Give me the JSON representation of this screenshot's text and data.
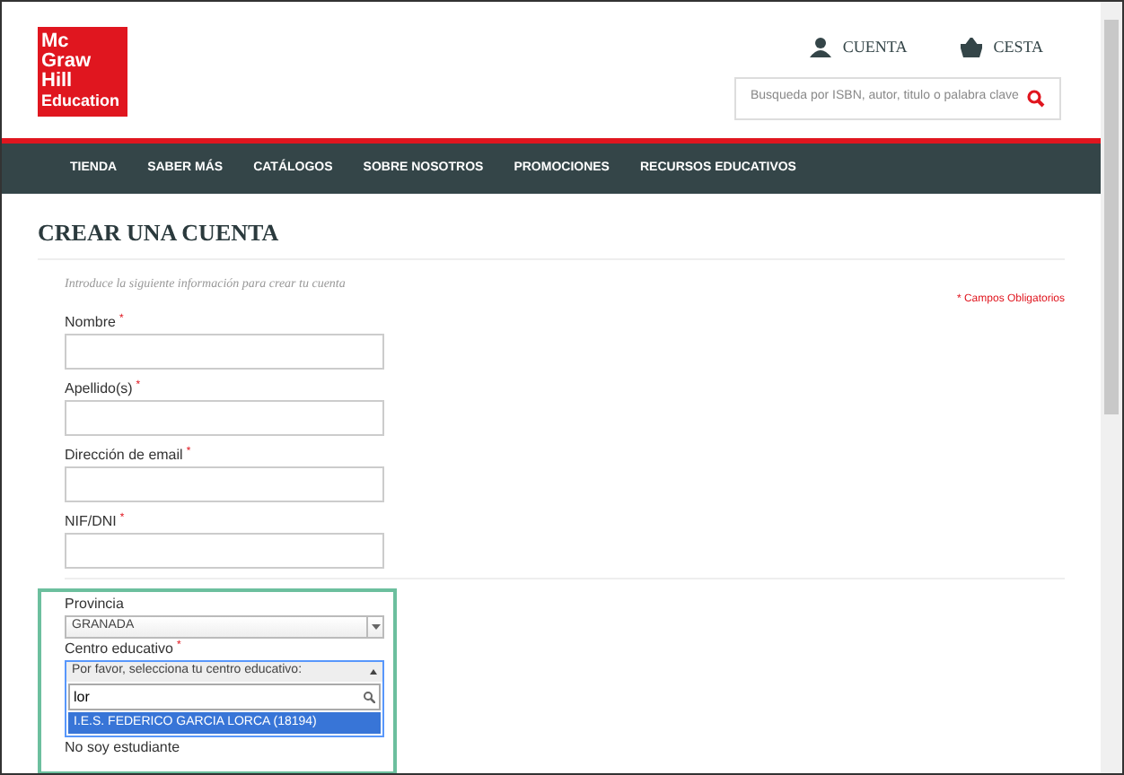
{
  "logo": {
    "lines": [
      "Mc",
      "Graw",
      "Hill",
      "Education"
    ]
  },
  "header_links": [
    {
      "kind": "account",
      "label": "CUENTA"
    },
    {
      "kind": "cart",
      "label": "CESTA"
    }
  ],
  "search": {
    "placeholder": "Busqueda por ISBN, autor, titulo o palabra clave"
  },
  "nav": [
    "TIENDA",
    "SABER MÁS",
    "CATÁLOGOS",
    "SOBRE NOSOTROS",
    "PROMOCIONES",
    "RECURSOS EDUCATIVOS"
  ],
  "page_title": "CREAR UNA CUENTA",
  "intro": "Introduce la siguiente información para crear tu cuenta",
  "required_note": "* Campos Obligatorios",
  "required_marker": "*",
  "fields": [
    {
      "label": "Nombre",
      "required": true
    },
    {
      "label": "Apellido(s)",
      "required": true
    },
    {
      "label": "Dirección de email",
      "required": true
    },
    {
      "label": "NIF/DNI",
      "required": true
    }
  ],
  "provincia": {
    "label": "Provincia",
    "value": "GRANADA"
  },
  "centro": {
    "label": "Centro educativo",
    "required": true,
    "placeholder": "Por favor, selecciona tu centro educativo:",
    "search_value": "lor",
    "options": [
      {
        "label": "I.E.S. FEDERICO GARCIA LORCA (18194)",
        "selected": true
      }
    ]
  },
  "next_label": "No soy estudiante"
}
